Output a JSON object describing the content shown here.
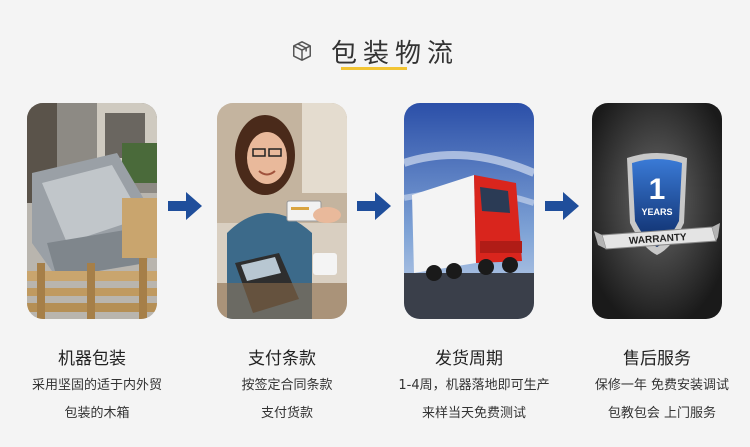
{
  "header": {
    "title": "包装物流",
    "icon": "box-icon"
  },
  "accent_color": "#f2c433",
  "arrow_color": "#1f4e9b",
  "steps": [
    {
      "title": "机器包装",
      "lines": [
        "采用坚固的适于内外贸",
        "包装的木箱"
      ],
      "image": "wooden-crate-machine-photo"
    },
    {
      "title": "支付条款",
      "lines": [
        "按签定合同条款",
        "支付货款"
      ],
      "image": "card-payment-photo"
    },
    {
      "title": "发货周期",
      "lines": [
        "1-4周，机器落地即可生产",
        "来样当天免费测试"
      ],
      "image": "red-truck-photo"
    },
    {
      "title": "售后服务",
      "lines": [
        "保修一年  免费安装调试",
        "包教包会  上门服务"
      ],
      "image": "warranty-shield-photo"
    }
  ],
  "warranty_badge": {
    "number": "1",
    "line1": "YEARS",
    "line2": "WARRANTY"
  }
}
